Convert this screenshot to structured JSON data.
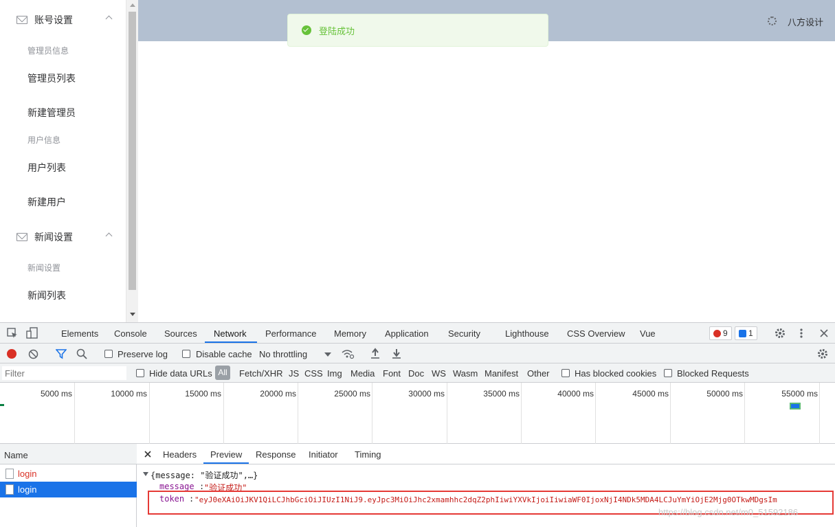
{
  "sidebar": {
    "group1": "账号设置",
    "sub1": "管理员信息",
    "item1": "管理员列表",
    "item2": "新建管理员",
    "sub2": "用户信息",
    "item3": "用户列表",
    "item4": "新建用户",
    "group2": "新闻设置",
    "sub3": "新闻设置",
    "item5": "新闻列表"
  },
  "header": {
    "user": "八方设计"
  },
  "toast": {
    "text": "登陆成功"
  },
  "devtools": {
    "tabs": [
      "Elements",
      "Console",
      "Sources",
      "Network",
      "Performance",
      "Memory",
      "Application",
      "Security",
      "Lighthouse",
      "CSS Overview",
      "Vue"
    ],
    "errors": "9",
    "messages": "1",
    "toolbar": {
      "preserve": "Preserve log",
      "disable": "Disable cache",
      "throttle": "No throttling"
    },
    "filter": {
      "placeholder": "Filter",
      "hide": "Hide data URLs",
      "all": "All",
      "types": [
        "Fetch/XHR",
        "JS",
        "CSS",
        "Img",
        "Media",
        "Font",
        "Doc",
        "WS",
        "Wasm",
        "Manifest",
        "Other"
      ],
      "blocked_cookies": "Has blocked cookies",
      "blocked_req": "Blocked Requests"
    },
    "timeline": [
      "5000 ms",
      "10000 ms",
      "15000 ms",
      "20000 ms",
      "25000 ms",
      "30000 ms",
      "35000 ms",
      "40000 ms",
      "45000 ms",
      "50000 ms",
      "55000 ms"
    ],
    "names": {
      "header": "Name",
      "rows": [
        "login",
        "login"
      ]
    },
    "detail": {
      "tabs": [
        "Headers",
        "Preview",
        "Response",
        "Initiator",
        "Timing"
      ],
      "summary": "{message: \"验证成功\",…}",
      "msg_key": "message",
      "msg_val": "\"验证成功\"",
      "token_key": "token",
      "token_val": "\"eyJ0eXAiOiJKV1QiLCJhbGciOiJIUzI1NiJ9.eyJpc3MiOiJhc2xmamhhc2dqZ2phIiwiYXVkIjoiIiwiaWF0IjoxNjI4NDk5MDA4LCJuYmYiOjE2Mjg0OTkwMDgsIm"
    },
    "watermark": "https://blog.csdn.net/m0_51592186"
  }
}
